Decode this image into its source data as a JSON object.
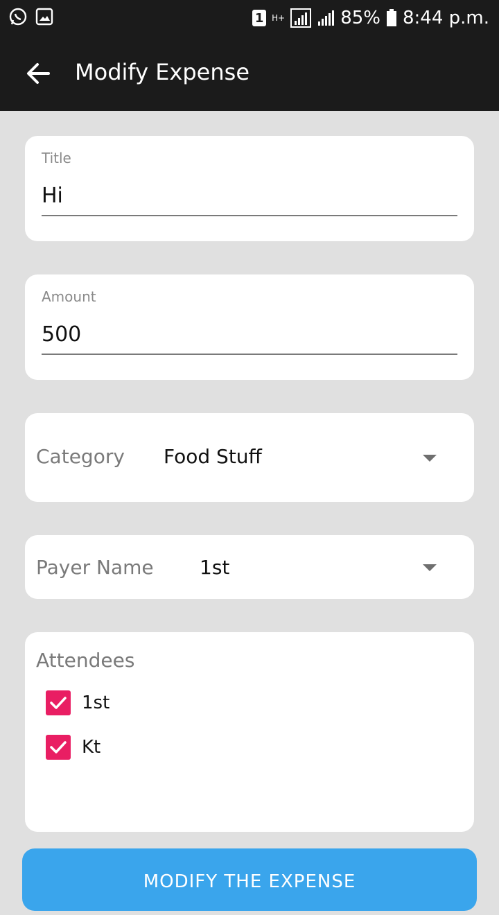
{
  "status_bar": {
    "sim_slot": "1",
    "network_type": "H+",
    "battery": "85%",
    "time": "8:44 p.m.",
    "left_icons": [
      "whatsapp-icon",
      "gallery-icon"
    ]
  },
  "app_bar": {
    "title": "Modify Expense",
    "back_icon": "arrow-back-icon"
  },
  "form": {
    "title_field": {
      "label": "Title",
      "value": "Hi"
    },
    "amount_field": {
      "label": "Amount",
      "value": "500"
    },
    "category": {
      "label": "Category",
      "value": "Food Stuff"
    },
    "payer": {
      "label": "Payer Name",
      "value": "1st"
    },
    "attendees": {
      "label": "Attendees",
      "items": [
        {
          "name": "1st",
          "checked": true
        },
        {
          "name": "Kt",
          "checked": true
        }
      ]
    }
  },
  "actions": {
    "submit_label": "MODIFY THE EXPENSE"
  },
  "colors": {
    "app_bar": "#1b1b1b",
    "background": "#e0e0e0",
    "checkbox": "#e91e63",
    "button": "#3aa5ec"
  }
}
